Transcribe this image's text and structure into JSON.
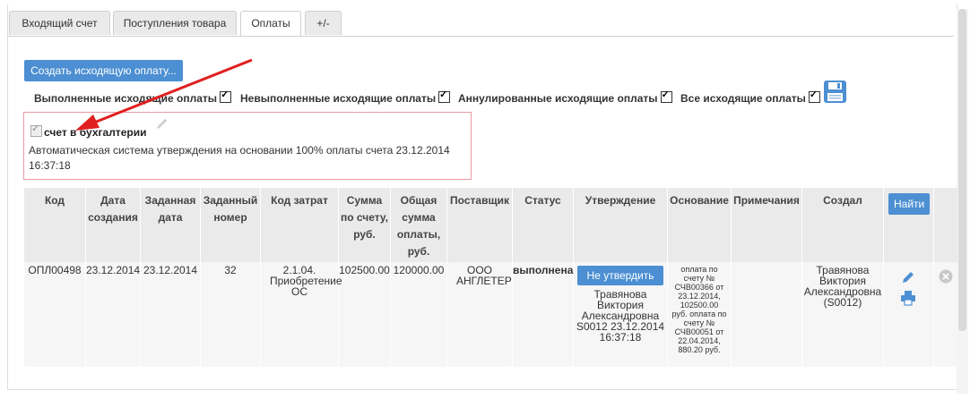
{
  "tabs": [
    {
      "label": "Входящий счет"
    },
    {
      "label": "Поступления товара"
    },
    {
      "label": "Оплаты"
    },
    {
      "label": "+/-"
    }
  ],
  "create_button": "Создать исходящую оплату...",
  "filters": [
    {
      "label": "Выполненные исходящие оплаты",
      "checked": true
    },
    {
      "label": "Невыполненные исходящие оплаты",
      "checked": true
    },
    {
      "label": "Аннулированные исходящие оплаты",
      "checked": true
    },
    {
      "label": "Все исходящие оплаты",
      "checked": true
    }
  ],
  "accounting": {
    "checkbox_label": "счет в бухгалтерии",
    "checked": true,
    "note": "Автоматическая система утверждения на основании 100% оплаты счета 23.12.2014 16:37:18"
  },
  "table": {
    "headers": {
      "code": "Код",
      "created": "Дата создания",
      "set_date": "Заданная дата",
      "set_number": "Заданный номер",
      "cost_code": "Код затрат",
      "sum_invoice": "Сумма по счету, руб.",
      "sum_total": "Общая сумма оплаты, руб.",
      "supplier": "Поставщик",
      "status": "Статус",
      "approval": "Утверждение",
      "basis": "Основание",
      "notes": "Примечания",
      "creator": "Создал"
    },
    "find_button": "Найти",
    "row": {
      "code": "ОПЛ00498",
      "created": "23.12.2014",
      "set_date": "23.12.2014",
      "set_number": "32",
      "cost_code": "2.1.04. Приобретение ОС",
      "sum_invoice": "102500.00",
      "sum_total": "120000.00",
      "supplier": "ООО АНГЛЕТЕР",
      "status": "выполнена",
      "approve_button": "Не утвердить",
      "approval_text": "Травянова Виктория Александровна S0012 23.12.2014 16:37:18",
      "basis": "оплата по счету № СЧВ00366 от 23.12.2014, 102500.00 руб. оплата по счету № СЧВ00051 от 22.04.2014, 880.20 руб.",
      "notes": "",
      "creator": "Травянова Виктория Александровна (S0012)"
    }
  },
  "colors": {
    "accent": "#4c8fd2",
    "arrow": "#e02020",
    "box_border": "#e89aa4",
    "header_bg": "#eaeaea"
  },
  "icons": [
    "save-icon",
    "pencil-icon",
    "edit-icon",
    "print-icon",
    "delete-icon",
    "arrow-annotation"
  ]
}
